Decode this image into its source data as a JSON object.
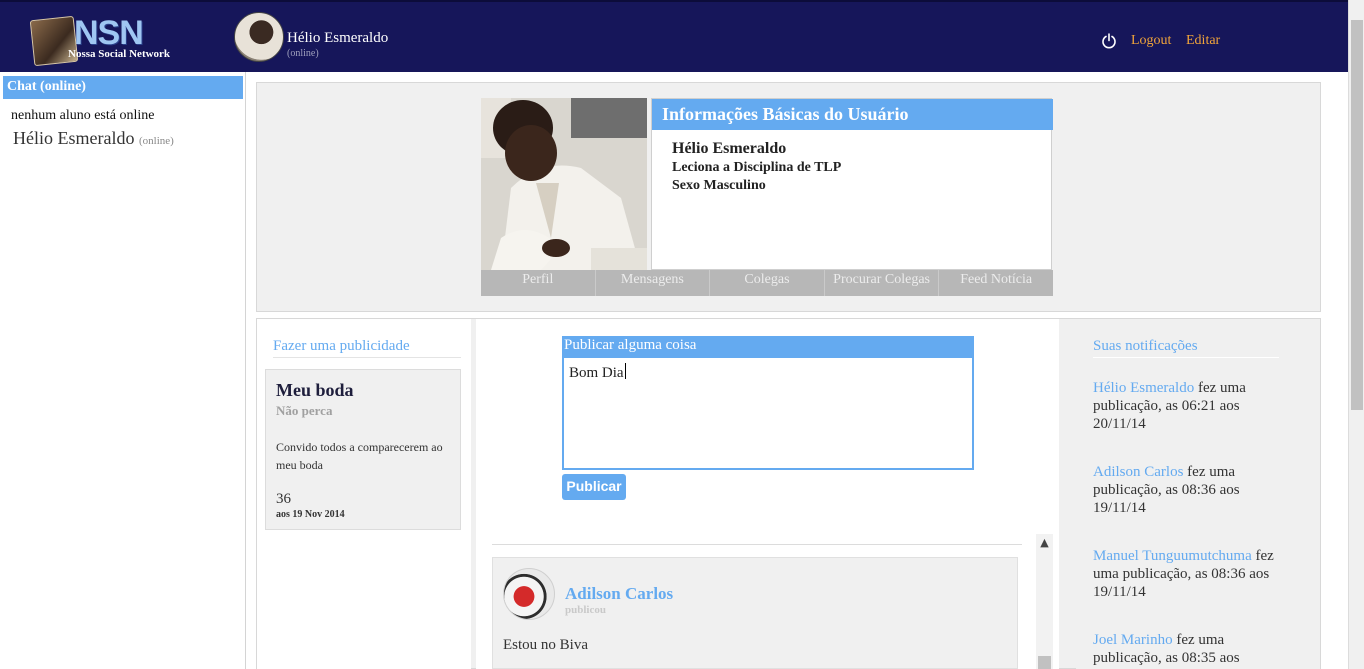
{
  "header": {
    "logo_text": "NSN",
    "logo_subtitle": "Nossa Social Network",
    "user_name": "Hélio Esmeraldo",
    "user_status": "(online)",
    "logout_label": "Logout",
    "edit_label": "Editar"
  },
  "chat": {
    "title": "Chat (online)",
    "empty_message": "nenhum aluno está online",
    "user_name": "Hélio Esmeraldo",
    "user_status": "(online)"
  },
  "profile": {
    "section_title": "Informações Básicas do Usuário",
    "name": "Hélio Esmeraldo",
    "subject": "Leciona a Disciplina de TLP",
    "sex": "Sexo Masculino",
    "tabs": [
      "Perfil",
      "Mensagens",
      "Colegas",
      "Procurar Colegas",
      "Feed Notícia"
    ]
  },
  "ad": {
    "heading": "Fazer uma publicidade",
    "title": "Meu boda",
    "subtitle": "Não perca",
    "body": "Convido todos a comparecerem ao meu boda",
    "count": "36",
    "date": "aos 19 Nov 2014"
  },
  "compose": {
    "heading": "Publicar alguma coisa",
    "text": "Bom Dia",
    "button_label": "Publicar"
  },
  "feed": {
    "posts": [
      {
        "author": "Adilson Carlos",
        "meta": "publicou",
        "body": "Estou no Biva"
      }
    ]
  },
  "notifications": {
    "heading": "Suas notificações",
    "items": [
      {
        "name": "Hélio Esmeraldo",
        "text": " fez uma publicação, as 06:21 aos 20/11/14"
      },
      {
        "name": "Adilson Carlos",
        "text": " fez uma publicação, as 08:36 aos 19/11/14"
      },
      {
        "name": "Manuel Tunguumutchuma",
        "text": " fez uma publicação, as 08:36 aos 19/11/14"
      },
      {
        "name": "Joel Marinho",
        "text": " fez uma publicação, as 08:35 aos"
      }
    ]
  },
  "colors": {
    "header_bg": "#16165a",
    "accent_blue": "#64aaf0",
    "link_orange": "#f1a43a",
    "panel_grey": "#f0f0f0"
  }
}
